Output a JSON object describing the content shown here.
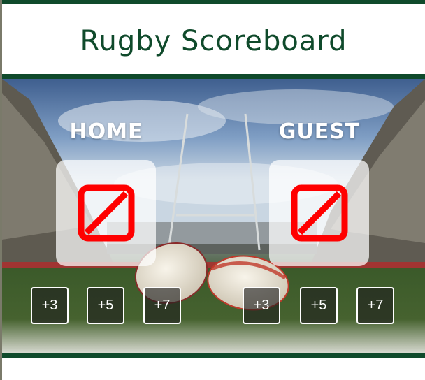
{
  "header": {
    "title": "Rugby Scoreboard"
  },
  "colors": {
    "brand": "#0f4a2b",
    "broken_image": "#ff0000",
    "button_border": "#ffffff"
  },
  "background": {
    "icon": "rugby-stadium-background"
  },
  "home": {
    "label": "HOME",
    "score_icon": "broken-image-icon",
    "buttons": [
      {
        "label": "+3"
      },
      {
        "label": "+5"
      },
      {
        "label": "+7"
      }
    ]
  },
  "guest": {
    "label": "GUEST",
    "score_icon": "broken-image-icon",
    "buttons": [
      {
        "label": "+3"
      },
      {
        "label": "+5"
      },
      {
        "label": "+7"
      }
    ]
  }
}
